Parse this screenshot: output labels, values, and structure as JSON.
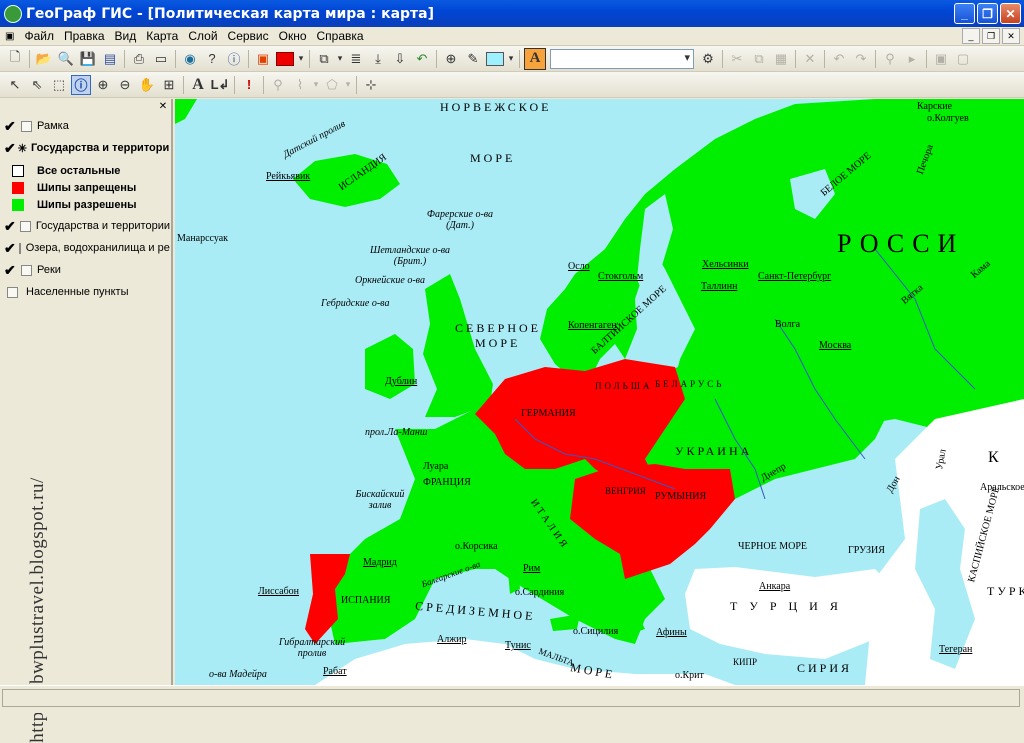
{
  "window": {
    "title": "ГеоГраф ГИС - [Политическая карта мира : карта]"
  },
  "menu": [
    "Файл",
    "Правка",
    "Вид",
    "Карта",
    "Слой",
    "Сервис",
    "Окно",
    "Справка"
  ],
  "layers": [
    {
      "label": "Рамка",
      "checked": true
    },
    {
      "label": "Государства и территории",
      "checked": true
    },
    {
      "label": "Государства и территории",
      "checked": true
    },
    {
      "label": "Озера, водохранилища и реки",
      "checked": true
    },
    {
      "label": "Реки",
      "checked": true
    },
    {
      "label": "Населенные пункты",
      "checked": false
    }
  ],
  "legend": [
    {
      "label": "Все остальные",
      "color": "#ffffff"
    },
    {
      "label": "Шипы запрещены",
      "color": "#ff0000"
    },
    {
      "label": "Шипы разрешены",
      "color": "#00ee00"
    }
  ],
  "watermark": "http://bbwplustravel.blogspot.ru/",
  "colors": {
    "sea": "#aaecf6",
    "allowed": "#00ee00",
    "banned": "#ff0000",
    "other": "#ffffff"
  },
  "map_labels": {
    "norwegian_sea": "НОРВЕЖСКОЕ",
    "sea": "МОРЕ",
    "russia": "РОССИ",
    "north_sea_1": "СЕВЕРНОЕ",
    "north_sea_2": "МОРЕ",
    "baltic": "БАЛТИЙСКОЕ МОРЕ",
    "white_sea": "БЕЛОЕ МОРЕ",
    "black_sea": "ЧЕРНОЕ МОРЕ",
    "mediterranean": "СРЕДИЗЕМНОЕ",
    "more_south": "МОРЕ",
    "ukraine": "УКРАИНА",
    "belarus": "БЕЛАРУСЬ",
    "poland": "ПОЛЬША",
    "germany": "ГЕРМАНИЯ",
    "france": "ФРАНЦИЯ",
    "spain": "ИСПАНИЯ",
    "italy": "ИТАЛИЯ",
    "turkey": "ТУРЦИЯ",
    "romania": "РУМЫНИЯ",
    "hungary": "ВЕНГРИЯ",
    "iceland": "ИСЛАНДИЯ",
    "reykjavik": "Рейкьявик",
    "denmark_strait": "Датский пролив",
    "faroe": "Фарерские о-ва (Дат.)",
    "shetland": "Шетландские о-ва (Брит.)",
    "orkney": "Оркнейские о-ва",
    "hebrides": "Гебридские о-ва",
    "oslo": "Осло",
    "stockholm": "Стокгольм",
    "helsinki": "Хельсинки",
    "spb": "Санкт-Петербург",
    "tallinn": "Таллинн",
    "copenhagen": "Копенгаген",
    "moscow": "Москва",
    "volga": "Волга",
    "dublin": "Дублин",
    "la_manche": "прол.Ла-Манш",
    "luara": "Луара",
    "biscay": "Бискайский залив",
    "corsica": "о.Корсика",
    "madrid": "Мадрид",
    "lisbon": "Лиссабон",
    "balearic": "Балеарские о-ва",
    "rome": "Рим",
    "sardinia": "о.Сардиния",
    "sicily": "о.Сицилия",
    "athens": "Афины",
    "crete": "о.Крит",
    "ankara": "Анкара",
    "georgia": "ГРУЗИЯ",
    "syria": "СИРИЯ",
    "cyprus": "КИПР",
    "tehran": "Тегеран",
    "caspian": "КАСПИЙСКОЕ МОРЕ",
    "aral": "Аральское море",
    "algeria": "Алжир",
    "tunis": "Тунис",
    "malta": "МАЛЬТА",
    "rabat": "Рабат",
    "gibraltar": "Гибралтарский пролив",
    "madeira": "о-ва Мадейра",
    "dnepr": "Днепр",
    "don": "Дон",
    "ural": "Урал",
    "karskie": "Карские",
    "kolguev": "о.Колгуев",
    "pechora": "Печора",
    "kama": "Кама",
    "vyatka": "Вятка",
    "turkm": "ТУРКМ",
    "k_letter": "К",
    "manarssuak": "Манарссуак"
  }
}
